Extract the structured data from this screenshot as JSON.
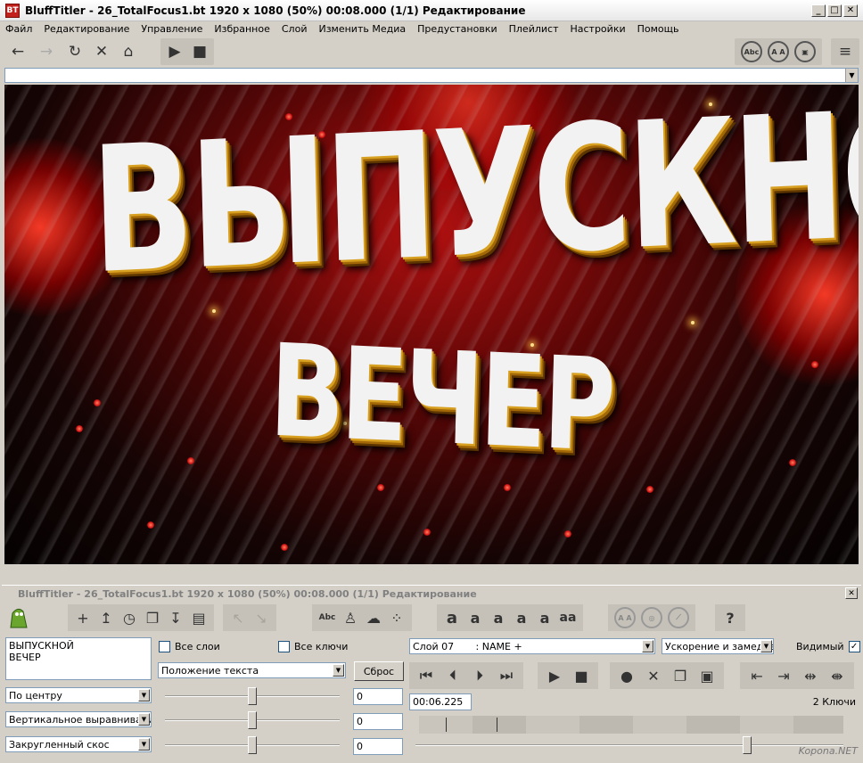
{
  "window": {
    "app_icon": "BT",
    "title": "BluffTitler - 26_TotalFocus1.bt 1920 x 1080 (50%) 00:08.000 (1/1) Редактирование",
    "minimize": "_",
    "maximize": "□",
    "close": "✕"
  },
  "menu": [
    "Файл",
    "Редактирование",
    "Управление",
    "Избранное",
    "Слой",
    "Изменить Медиа",
    "Предустановки",
    "Плейлист",
    "Настройки",
    "Помощь"
  ],
  "toolbar": {
    "back": "←",
    "forward": "→",
    "reload": "↻",
    "stop_nav": "✕",
    "home": "⌂",
    "play": "▶",
    "stop": "■",
    "abc": "Abc",
    "aa": "A A",
    "doc": "▣",
    "menu": "≡"
  },
  "address": {
    "value": ""
  },
  "viewport": {
    "line1": "ВЫПУСКНОЙ",
    "line2": "ВЕЧЕР"
  },
  "panel": {
    "title": "BluffTitler - 26_TotalFocus1.bt 1920 x 1080 (50%) 00:08.000 (1/1) Редактирование",
    "close": "✕",
    "tools": {
      "add": "+",
      "open": "↥",
      "clock": "◷",
      "layers": "❐",
      "import": "↧",
      "film": "▤",
      "arrow_nw": "↖",
      "arrow_ne": "↘",
      "abc": "Abc",
      "bottle": "♙",
      "blob": "☁",
      "dots": "⁘",
      "a1": "a",
      "a2": "a",
      "a3": "a",
      "a4": "a",
      "a5": "a",
      "a6": "aa",
      "r1": "A A",
      "r2": "◎",
      "r3": "⟋",
      "help": "?"
    },
    "text_value": "ВЫПУСКНОЙ\nВЕЧЕР",
    "all_layers_label": "Все слои",
    "all_keys_label": "Все ключи",
    "property_select": "Положение текста",
    "reset_label": "Сброс",
    "align_select": "По центру",
    "valign_select": "Вертикальное выравнивание",
    "bevel_select": "Закругленный скос",
    "value1": "0",
    "value2": "0",
    "value3": "0",
    "layer_select": "Слой 07       : NAME +",
    "ease_select": "Ускорение и замедление",
    "visible_label": "Видимый",
    "visible_checked": "✓",
    "time_value": "00:06.225",
    "keys_count": "2 Ключи",
    "transport": {
      "first": "⏮",
      "prev": "⏴",
      "next": "⏵",
      "last": "⏭",
      "play": "▶",
      "stop": "■",
      "record": "●",
      "delete": "✕",
      "copy": "❐",
      "save": "▣",
      "k1": "⇤",
      "k2": "⇥",
      "k3": "⇹",
      "k4": "⇼"
    },
    "timeline_progress": 0.78
  },
  "watermark": "Kopona.NET"
}
